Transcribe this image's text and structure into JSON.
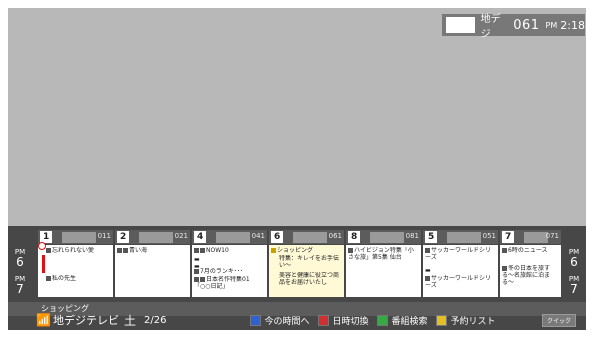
{
  "status": {
    "network": "地デジ",
    "channel": "061",
    "ampm": "PM",
    "time": "2:18"
  },
  "channels": [
    {
      "num": "1",
      "code": "011"
    },
    {
      "num": "2",
      "code": "021"
    },
    {
      "num": "4",
      "code": "041"
    },
    {
      "num": "6",
      "code": "061"
    },
    {
      "num": "8",
      "code": "081"
    },
    {
      "num": "5",
      "code": "051"
    },
    {
      "num": "7",
      "code": "071"
    }
  ],
  "programs": [
    [
      "忘れられない愛",
      "私の先生"
    ],
    [
      "青い海"
    ],
    [
      "NOW10",
      "7月のランキ･･･",
      "日本名作特集01「○○日記」"
    ],
    [
      "ショッピング",
      "特集：キレイをお手伝い〜",
      "美容と健康に役立つ商品をお届けいたし"
    ],
    [
      "ハイビジョン特集「小さな旅」第5集 仙台"
    ],
    [
      "サッカーワールドシリーズ",
      "サッカーワールドシリーズ"
    ],
    [
      "6時のニュース",
      "冬の日本を旅する〜名旅館に泊まる〜"
    ]
  ],
  "times": {
    "left_top": {
      "ampm": "PM",
      "hour": "6"
    },
    "left_bottom": {
      "ampm": "PM",
      "hour": "7"
    },
    "right_top": {
      "ampm": "PM",
      "hour": "6"
    },
    "right_bottom": {
      "ampm": "PM",
      "hour": "7"
    }
  },
  "genre": "ショッピング",
  "bottom": {
    "network": "地デジテレビ",
    "dow": "土",
    "date": "2/26",
    "blue_label": "今の時間へ",
    "red_label": "日時切換",
    "green_label": "番組検索",
    "yellow_label": "予約リスト",
    "quick_label": "クイック"
  },
  "colors": {
    "blue": "#2f62d0",
    "red": "#d02f2f",
    "green": "#36a845",
    "yellow": "#e3bf26",
    "now_line": "#e01010",
    "selected": "#fff9d6"
  }
}
